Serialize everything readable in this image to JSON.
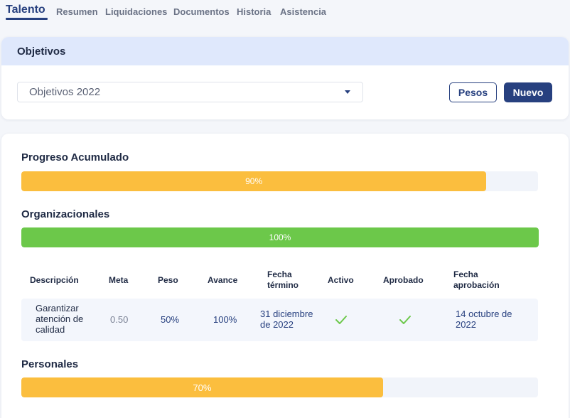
{
  "nav": {
    "tabs": [
      "Talento",
      "Resumen",
      "Liquidaciones",
      "Documentos",
      "Historia",
      "Asistencia"
    ]
  },
  "objectives_card": {
    "title": "Objetivos",
    "select_value": "Objetivos 2022",
    "weights_button": "Pesos",
    "new_button": "Nuevo"
  },
  "progress": {
    "accumulated": {
      "title": "Progreso Acumulado",
      "percent_label": "90%",
      "fraction": 0.9
    },
    "organizational": {
      "title": "Organizacionales",
      "percent_label": "100%",
      "fraction": 1.0
    },
    "personal": {
      "title": "Personales",
      "percent_label": "70%",
      "fraction": 0.7
    }
  },
  "table": {
    "headers": [
      "Descripción",
      "Meta",
      "Peso",
      "Avance",
      "Fecha término",
      "Activo",
      "Aprobado",
      "Fecha aprobación"
    ],
    "rows": [
      {
        "description": "Garantizar atención de calidad",
        "goal": "0.50",
        "weight": "50%",
        "progress": "100%",
        "end_date": "31 diciembre de 2022",
        "active": "check-icon",
        "approved": "check-icon",
        "approval_date": "14 octubre de 2022"
      }
    ]
  },
  "colors": {
    "primary": "#27407f",
    "yellow": "#fbbe3e",
    "green": "#6cc84a",
    "header_bg": "#dfe8fc"
  }
}
